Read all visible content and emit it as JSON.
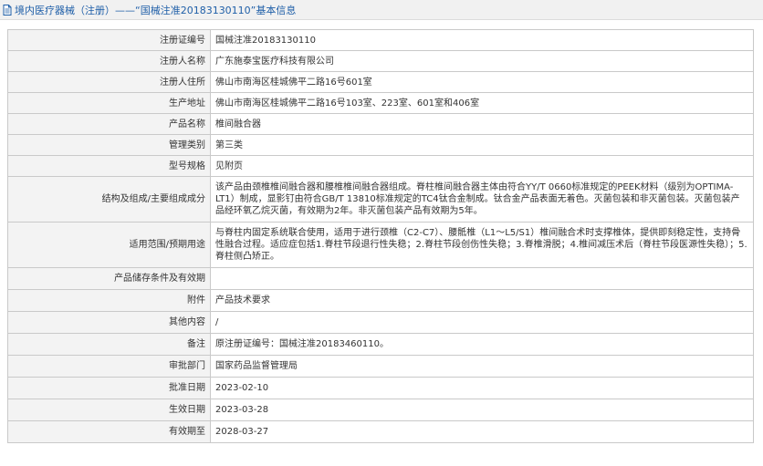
{
  "header": {
    "title": "境内医疗器械（注册）——“国械注准20183130110”基本信息"
  },
  "rows": [
    {
      "label": "注册证编号",
      "value": "国械注准20183130110"
    },
    {
      "label": "注册人名称",
      "value": "广东施泰宝医疗科技有限公司"
    },
    {
      "label": "注册人住所",
      "value": "佛山市南海区桂城佛平二路16号601室"
    },
    {
      "label": "生产地址",
      "value": "佛山市南海区桂城佛平二路16号103室、223室、601室和406室"
    },
    {
      "label": "产品名称",
      "value": "椎间融合器"
    },
    {
      "label": "管理类别",
      "value": "第三类"
    },
    {
      "label": "型号规格",
      "value": "见附页"
    },
    {
      "label": "结构及组成/主要组成成分",
      "value": "该产品由颈椎椎间融合器和腰椎椎间融合器组成。脊柱椎间融合器主体由符合YY/T 0660标准规定的PEEK材料（级别为OPTIMA-LT1）制成，显影钉由符合GB/T 13810标准规定的TC4钛合金制成。钛合金产品表面无着色。灭菌包装和非灭菌包装。灭菌包装产品经环氧乙烷灭菌，有效期为2年。非灭菌包装产品有效期为5年。"
    },
    {
      "label": "适用范围/预期用途",
      "value": "与脊柱内固定系统联合使用，适用于进行颈椎（C2-C7）、腰骶椎（L1～L5/S1）椎间融合术时支撑椎体，提供即刻稳定性，支持骨性融合过程。适应症包括1.脊柱节段退行性失稳；2.脊柱节段创伤性失稳；3.脊椎滑脱；4.椎间减压术后（脊柱节段医源性失稳）；5.脊柱侧凸矫正。"
    },
    {
      "label": "产品储存条件及有效期",
      "value": ""
    },
    {
      "label": "附件",
      "value": "产品技术要求"
    },
    {
      "label": "其他内容",
      "value": "/"
    },
    {
      "label": "备注",
      "value": "原注册证编号：国械注准20183460110。"
    },
    {
      "label": "审批部门",
      "value": "国家药品监督管理局"
    },
    {
      "label": "批准日期",
      "value": "2023-02-10"
    },
    {
      "label": "生效日期",
      "value": "2023-03-28"
    },
    {
      "label": "有效期至",
      "value": "2028-03-27"
    }
  ]
}
